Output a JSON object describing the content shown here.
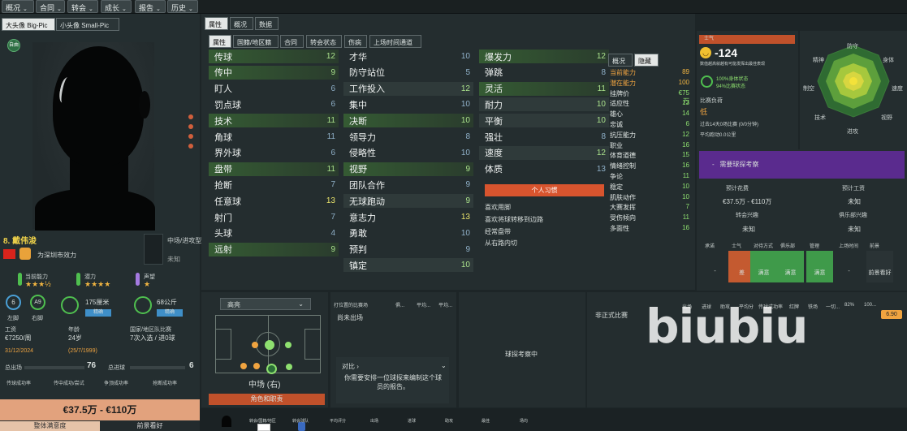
{
  "topnav": [
    "概况",
    "合同",
    "转会",
    "成长",
    "报告",
    "历史"
  ],
  "left": {
    "tabs": [
      "大头像 Big-Pic",
      "小头像 Small-Pic"
    ],
    "badge_small": "自由",
    "player_name": "8. 戴伟浚",
    "club": "为深圳市效力",
    "position_label": "中场/进攻型中...",
    "position_sub": "未知",
    "ability_labels": [
      "当前能力",
      "潜力",
      "声望"
    ],
    "ability_stars": [
      "★★★½",
      "★★★★",
      "★"
    ],
    "foot_labels": [
      "左脚",
      "右脚"
    ],
    "foot_codes": [
      "6",
      "A9"
    ],
    "height": "175厘米",
    "height_tag": "精确",
    "weight": "68公斤",
    "weight_tag": "精确",
    "wage_h": "工资",
    "wage": "€7250/周",
    "age_h": "年龄",
    "age": "24岁",
    "nat_h": "国家/地区队比赛",
    "nat": "7次入选 / 进0球",
    "contract_end": "31/12/2024",
    "dob": "(25/7/1999)",
    "total1_label": "总出场",
    "total1": "76",
    "total2_label": "总进球",
    "total2": "6",
    "stat_cols": [
      "传球成功率",
      "传中成功/尝试",
      "争顶成功率",
      "抢断成功率"
    ],
    "value": "€37.5万 - €110万",
    "bottom_tabs": [
      "整体满意度",
      "前景看好"
    ]
  },
  "main": {
    "tabs": [
      "属性",
      "概况",
      "数据"
    ],
    "subtabs": [
      "属性",
      "国籍/地区籍",
      "合同",
      "转会状态",
      "伤病",
      "上场时间通道"
    ],
    "col1": [
      {
        "n": "传球",
        "v": "12",
        "s": "g"
      },
      {
        "n": "传中",
        "v": "9",
        "s": "g"
      },
      {
        "n": "盯人",
        "v": "6",
        "s": ""
      },
      {
        "n": "罚点球",
        "v": "6",
        "s": ""
      },
      {
        "n": "技术",
        "v": "11",
        "s": "g"
      },
      {
        "n": "角球",
        "v": "11",
        "s": ""
      },
      {
        "n": "界外球",
        "v": "6",
        "s": ""
      },
      {
        "n": "盘带",
        "v": "11",
        "s": "g"
      },
      {
        "n": "抢断",
        "v": "7",
        "s": ""
      },
      {
        "n": "任意球",
        "v": "13",
        "s": "y"
      },
      {
        "n": "射门",
        "v": "7",
        "s": ""
      },
      {
        "n": "头球",
        "v": "4",
        "s": ""
      },
      {
        "n": "远射",
        "v": "9",
        "s": "g"
      }
    ],
    "col2": [
      {
        "n": "才华",
        "v": "10",
        "s": ""
      },
      {
        "n": "防守站位",
        "v": "5",
        "s": ""
      },
      {
        "n": "工作投入",
        "v": "12",
        "s": "gy"
      },
      {
        "n": "集中",
        "v": "10",
        "s": ""
      },
      {
        "n": "决断",
        "v": "10",
        "s": "g"
      },
      {
        "n": "领导力",
        "v": "8",
        "s": ""
      },
      {
        "n": "侵略性",
        "v": "10",
        "s": ""
      },
      {
        "n": "视野",
        "v": "9",
        "s": "g"
      },
      {
        "n": "团队合作",
        "v": "9",
        "s": ""
      },
      {
        "n": "无球跑动",
        "v": "9",
        "s": "gy"
      },
      {
        "n": "意志力",
        "v": "13",
        "s": "y"
      },
      {
        "n": "勇敢",
        "v": "10",
        "s": ""
      },
      {
        "n": "预判",
        "v": "9",
        "s": ""
      },
      {
        "n": "镇定",
        "v": "10",
        "s": "gy"
      }
    ],
    "col3": [
      {
        "n": "爆发力",
        "v": "12",
        "s": "g"
      },
      {
        "n": "弹跳",
        "v": "8",
        "s": ""
      },
      {
        "n": "灵活",
        "v": "11",
        "s": "g"
      },
      {
        "n": "耐力",
        "v": "10",
        "s": "gy"
      },
      {
        "n": "平衡",
        "v": "10",
        "s": "gy"
      },
      {
        "n": "强壮",
        "v": "8",
        "s": ""
      },
      {
        "n": "速度",
        "v": "12",
        "s": "gy"
      },
      {
        "n": "体质",
        "v": "13",
        "s": ""
      }
    ],
    "habits_title": "个人习惯",
    "habits": [
      "喜欢用脚",
      "喜欢将球转移到边路",
      "经常盘带",
      "从右路内切"
    ],
    "hidden_tabs": [
      "概况",
      "隐藏"
    ],
    "hidden": [
      {
        "n": "当前能力",
        "v": "89",
        "c": "o"
      },
      {
        "n": "潜在能力",
        "v": "100",
        "c": "o"
      },
      {
        "n": "挂牌价",
        "v": "€75万",
        "c": ""
      },
      {
        "n": "适应性",
        "v": "13",
        "c": ""
      },
      {
        "n": "雄心",
        "v": "14",
        "c": ""
      },
      {
        "n": "忠诚",
        "v": "6",
        "c": ""
      },
      {
        "n": "抗压能力",
        "v": "12",
        "c": ""
      },
      {
        "n": "职业",
        "v": "16",
        "c": ""
      },
      {
        "n": "体育道德",
        "v": "15",
        "c": ""
      },
      {
        "n": "情绪控制",
        "v": "16",
        "c": ""
      },
      {
        "n": "争论",
        "v": "11",
        "c": ""
      },
      {
        "n": "稳定",
        "v": "10",
        "c": ""
      },
      {
        "n": "肌肤动作",
        "v": "10",
        "c": ""
      },
      {
        "n": "大赛发挥",
        "v": "7",
        "c": ""
      },
      {
        "n": "受伤倾向",
        "v": "11",
        "c": ""
      },
      {
        "n": "多面性",
        "v": "16",
        "c": ""
      }
    ]
  },
  "rightp": {
    "morale_title": "士气",
    "morale": "-124",
    "morale_sub": "数值越高就越有可能发挥出最佳表现",
    "cond1": "100%身体状态",
    "cond2": "94%比赛状态",
    "load_h": "比赛负荷",
    "load": "低",
    "load_sub1": "过去14天0场比赛 (0/0分钟)",
    "load_sub2": "平均跑动0.0公里",
    "radar_labels": [
      "防守",
      "身体",
      "速度",
      "视野",
      "进攻",
      "技术",
      "制空",
      "精神"
    ],
    "scout": "需要球探考察",
    "fin_h": [
      "预计花费",
      "预计工资"
    ],
    "fin": [
      "€37.5万 - €110万",
      "未知"
    ],
    "fin2_h": [
      "转会兴趣",
      "俱乐部兴趣"
    ],
    "fin2": [
      "未知",
      "未知"
    ],
    "rel_h": [
      "承诺",
      "士气",
      "对待方式",
      "俱乐部",
      "管理",
      "上场时间",
      "前景"
    ],
    "rel_v": [
      "-",
      "差",
      "满意",
      "满意",
      "满意",
      "-",
      "前景看好"
    ]
  },
  "pitch": {
    "dropdown": "高亮",
    "position": "中场 (右)",
    "role_btn": "角色和职责"
  },
  "middle": {
    "headers": [
      "打位置的比赛场",
      "俱...",
      "平均...",
      "平均..."
    ],
    "first": "尚未出场",
    "compare": "对比",
    "compare_text": "你需要安排一位球探来编制这个球员的报告。",
    "scouting": "球探考察中",
    "nonofficial": "非正式比赛",
    "right_headers": [
      "出场",
      "进球",
      "助攻",
      "平均分",
      "传球成功率",
      "红牌",
      "铁场",
      "一切...",
      "82%",
      "100..."
    ],
    "rating": "6.90",
    "bottom_headers": [
      "转会/国籍/地区",
      "转会球队",
      "平均评分",
      "出场",
      "进球",
      "助攻",
      "最佳",
      "场均"
    ]
  },
  "watermark": "biubiu"
}
